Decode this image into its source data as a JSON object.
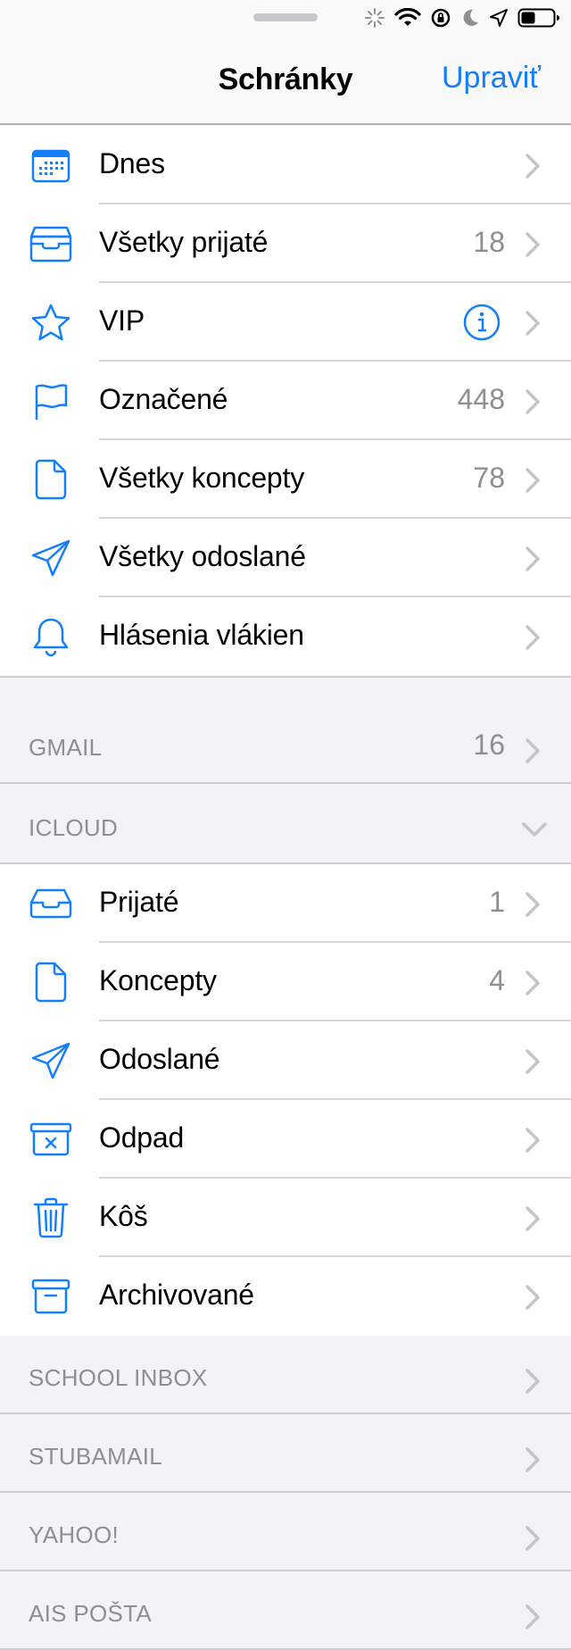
{
  "nav": {
    "title": "Schránky",
    "edit_label": "Upraviť"
  },
  "smart_mailboxes": [
    {
      "label": "Dnes",
      "count": "",
      "icon": "calendar-icon"
    },
    {
      "label": "Všetky prijaté",
      "count": "18",
      "icon": "inbox-tray-icon"
    },
    {
      "label": "VIP",
      "count": "",
      "icon": "star-icon",
      "info": true
    },
    {
      "label": "Označené",
      "count": "448",
      "icon": "flag-icon"
    },
    {
      "label": "Všetky koncepty",
      "count": "78",
      "icon": "document-icon"
    },
    {
      "label": "Všetky odoslané",
      "count": "",
      "icon": "paper-plane-icon"
    },
    {
      "label": "Hlásenia vlákien",
      "count": "",
      "icon": "bell-icon"
    }
  ],
  "accounts": {
    "gmail": {
      "label": "GMAIL",
      "count": "16"
    },
    "icloud": {
      "label": "ICLOUD"
    },
    "school_inbox": {
      "label": "SCHOOL INBOX"
    },
    "stubamail": {
      "label": "STUBAMAIL"
    },
    "yahoo": {
      "label": "YAHOO!"
    },
    "ais_posta": {
      "label": "AIS POŠTA"
    }
  },
  "icloud_mailboxes": [
    {
      "label": "Prijaté",
      "count": "1",
      "icon": "inbox-icon"
    },
    {
      "label": "Koncepty",
      "count": "4",
      "icon": "document-icon"
    },
    {
      "label": "Odoslané",
      "count": "",
      "icon": "paper-plane-icon"
    },
    {
      "label": "Odpad",
      "count": "",
      "icon": "junk-box-icon"
    },
    {
      "label": "Kôš",
      "count": "",
      "icon": "trash-icon"
    },
    {
      "label": "Archivované",
      "count": "",
      "icon": "archive-box-icon"
    }
  ],
  "colors": {
    "accent": "#147efb",
    "secondary_text": "#8e8e93",
    "chevron": "#c4c4c7",
    "background": "#f2f2f7"
  }
}
